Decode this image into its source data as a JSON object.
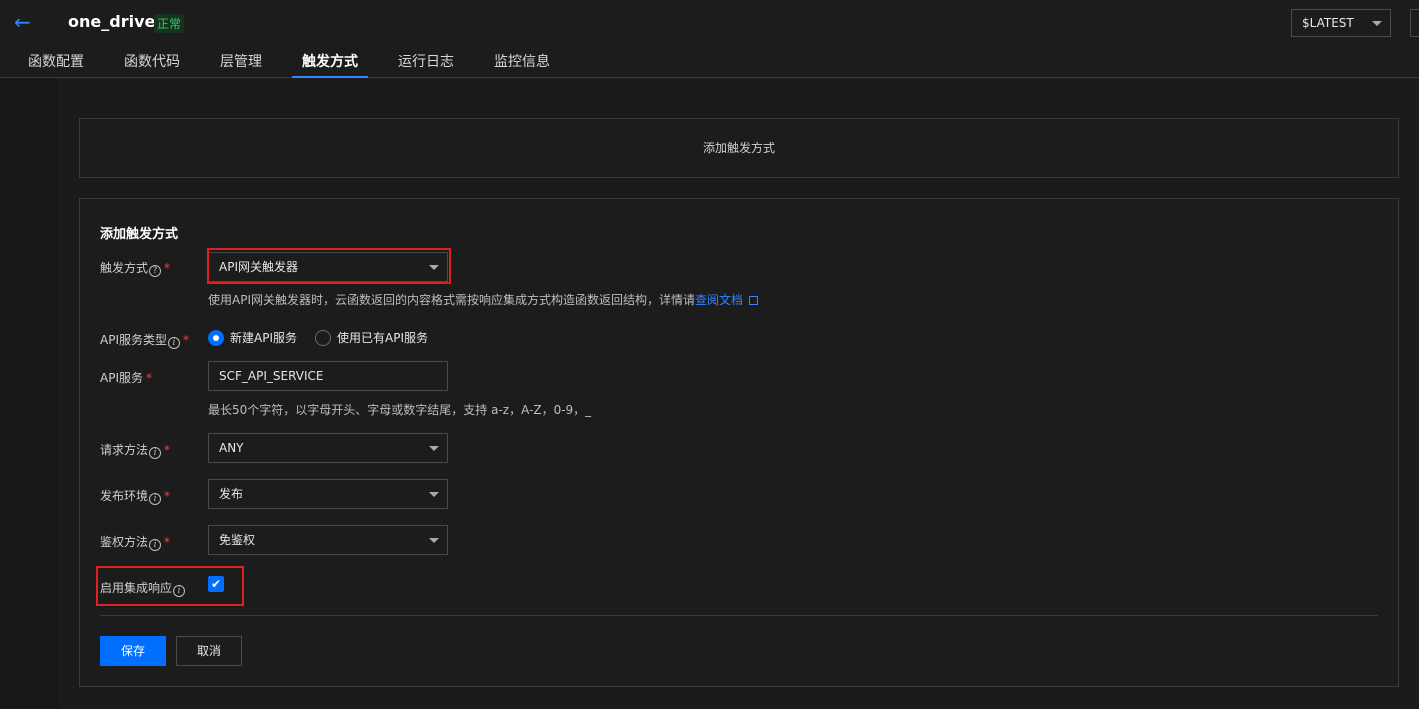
{
  "header": {
    "function_name": "one_drive",
    "status": "正常",
    "version": "$LATEST"
  },
  "tabs": [
    {
      "label": "函数配置"
    },
    {
      "label": "函数代码"
    },
    {
      "label": "层管理"
    },
    {
      "label": "触发方式",
      "active": true
    },
    {
      "label": "运行日志"
    },
    {
      "label": "监控信息"
    }
  ],
  "add_trigger_card": {
    "label": "添加触发方式"
  },
  "form": {
    "title": "添加触发方式",
    "trigger": {
      "label": "触发方式",
      "value": "API网关触发器",
      "hint": "使用API网关触发器时，云函数返回的内容格式需按响应集成方式构造函数返回结构，详情请",
      "hint_link": "查阅文档"
    },
    "api_service_type": {
      "label": "API服务类型",
      "options": [
        "新建API服务",
        "使用已有API服务"
      ],
      "selected": "新建API服务"
    },
    "api_service": {
      "label": "API服务",
      "value": "SCF_API_SERVICE",
      "hint": "最长50个字符，以字母开头、字母或数字结尾，支持 a-z，A-Z，0-9，_"
    },
    "request_method": {
      "label": "请求方法",
      "value": "ANY"
    },
    "environment": {
      "label": "发布环境",
      "value": "发布"
    },
    "auth_method": {
      "label": "鉴权方法",
      "value": "免鉴权"
    },
    "integration_response": {
      "label": "启用集成响应",
      "checked": true
    },
    "save_label": "保存",
    "cancel_label": "取消"
  },
  "colors": {
    "accent": "#006eff",
    "link": "#2f86ff",
    "status_green": "#29cc6a",
    "highlight_red": "#e02020",
    "required": "#e54545"
  }
}
